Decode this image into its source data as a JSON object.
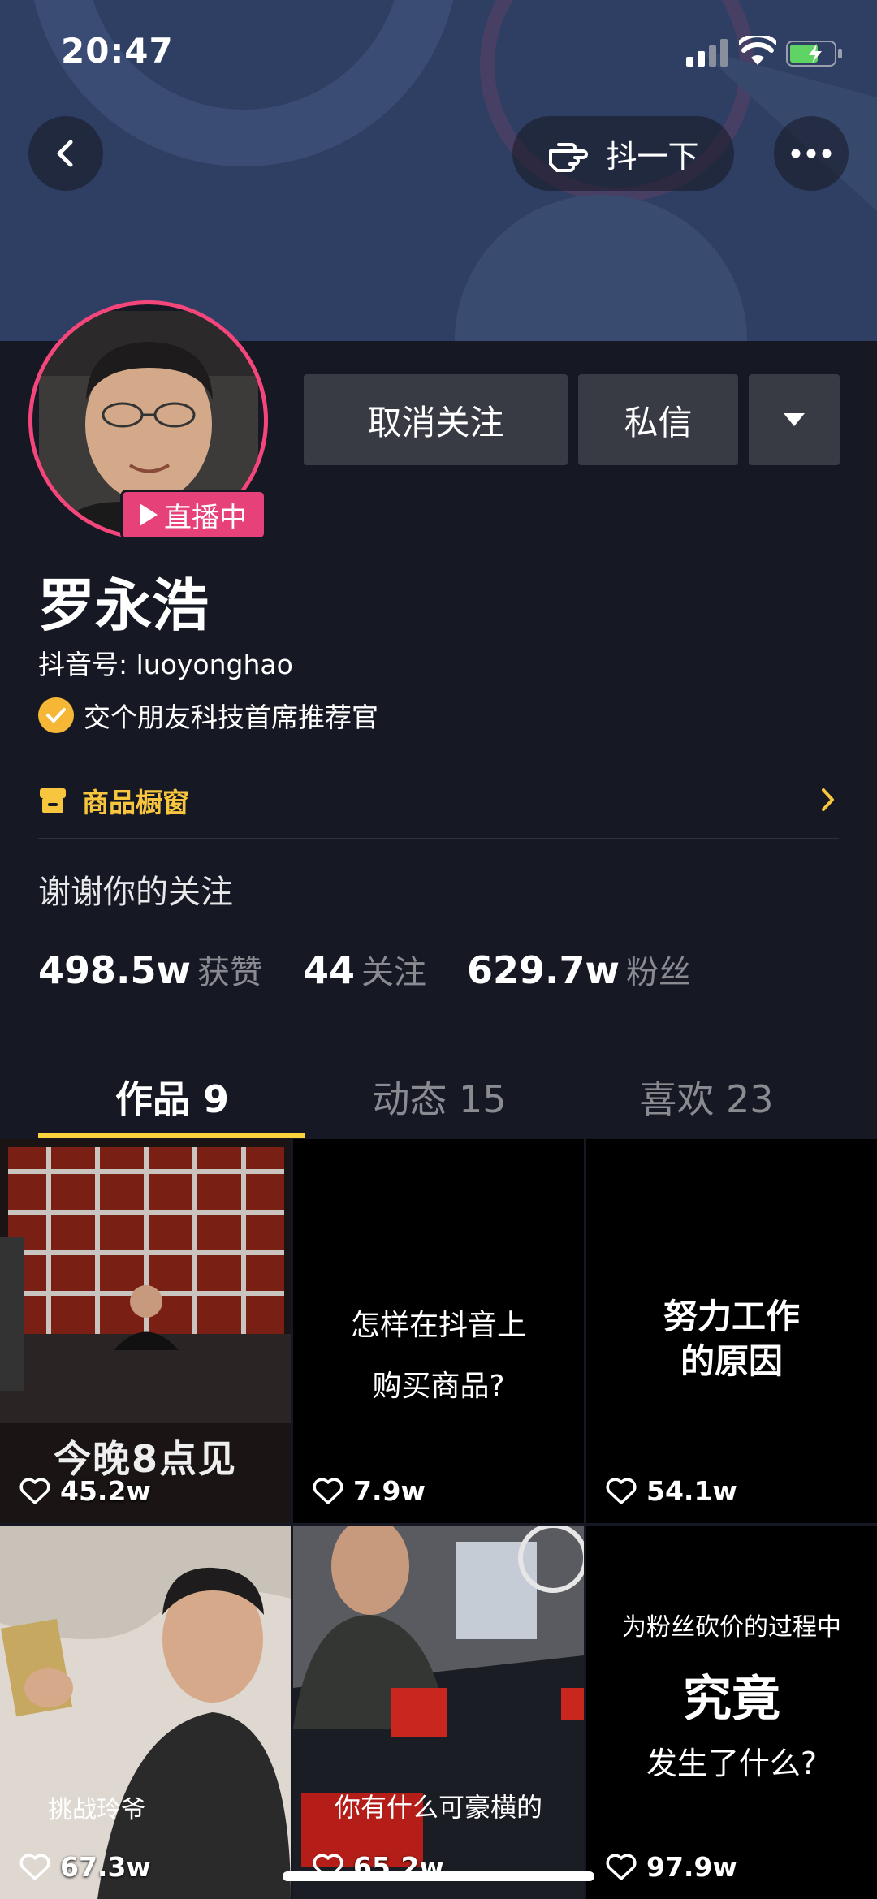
{
  "status_bar": {
    "time": "20:47"
  },
  "header": {
    "shake_label": "抖一下"
  },
  "profile": {
    "live_badge": "直播中",
    "name": "罗永浩",
    "douyin_id": "抖音号: luoyonghao",
    "verification": "交个朋友科技首席推荐官",
    "bio": "谢谢你的关注"
  },
  "actions": {
    "unfollow": "取消关注",
    "message": "私信"
  },
  "shop": {
    "label": "商品橱窗"
  },
  "stats": [
    {
      "value": "498.5w",
      "label": "获赞"
    },
    {
      "value": "44",
      "label": "关注"
    },
    {
      "value": "629.7w",
      "label": "粉丝"
    }
  ],
  "tabs": [
    {
      "label": "作品 9"
    },
    {
      "label": "动态 15"
    },
    {
      "label": "喜欢 23"
    }
  ],
  "videos": [
    {
      "likes": "45.2w",
      "caption": "今晚8点见"
    },
    {
      "likes": "7.9w",
      "caption_line1": "怎样在抖音上",
      "caption_line2": "购买商品?"
    },
    {
      "likes": "54.1w",
      "caption_line1": "努力工作",
      "caption_line2": "的原因"
    },
    {
      "likes": "67.3w",
      "caption": "挑战玲爷"
    },
    {
      "likes": "65.2w",
      "caption": "你有什么可豪横的"
    },
    {
      "likes": "97.9w",
      "caption_line1": "为粉丝砍价的过程中",
      "caption_line2": "究竟",
      "caption_line3": "发生了什么?"
    }
  ],
  "colors": {
    "accent_yellow": "#fcd33c",
    "live_pink": "#e7417a",
    "background": "#161823"
  }
}
